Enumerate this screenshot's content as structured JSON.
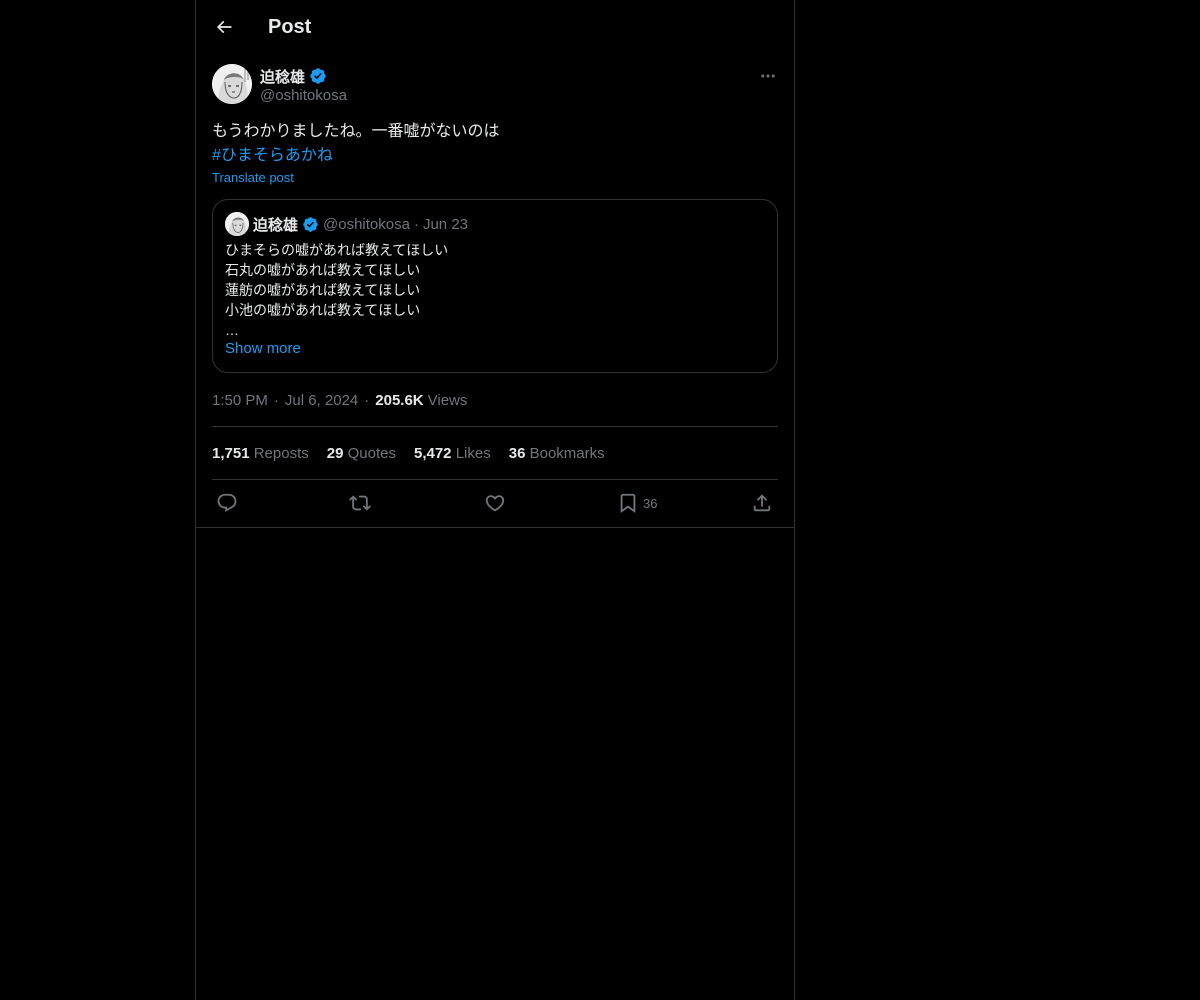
{
  "header": {
    "title": "Post"
  },
  "post": {
    "author_name": "迫稔雄",
    "handle": "@oshitokosa",
    "text_line1": "もうわかりましたね。一番嘘がないのは",
    "hashtag": "#ひまそらあかね",
    "translate_label": "Translate post",
    "quote": {
      "author_name": "迫稔雄",
      "handle": "@oshitokosa",
      "separator": "·",
      "date": "Jun 23",
      "lines": [
        "ひまそらの嘘があれば教えてほしい",
        "石丸の嘘があれば教えてほしい",
        "蓮舫の嘘があれば教えてほしい",
        "小池の嘘があれば教えてほしい",
        "…"
      ],
      "show_more": "Show more"
    },
    "meta": {
      "time": "1:50 PM",
      "separator": "·",
      "date": "Jul 6, 2024",
      "views_count": "205.6K",
      "views_label": "Views"
    },
    "stats": {
      "reposts_count": "1,751",
      "reposts_label": "Reposts",
      "quotes_count": "29",
      "quotes_label": "Quotes",
      "likes_count": "5,472",
      "likes_label": "Likes",
      "bookmarks_count": "36",
      "bookmarks_label": "Bookmarks"
    },
    "actions": {
      "bookmark_count": "36",
      "icons": [
        "reply-icon",
        "repost-icon",
        "like-icon",
        "bookmark-icon",
        "share-icon"
      ]
    }
  },
  "colors": {
    "background": "#000000",
    "text": "#e7e9ea",
    "secondary": "#71767b",
    "accent": "#1d9bf0",
    "border": "#2f3336",
    "verified": "#1d9bf0"
  }
}
